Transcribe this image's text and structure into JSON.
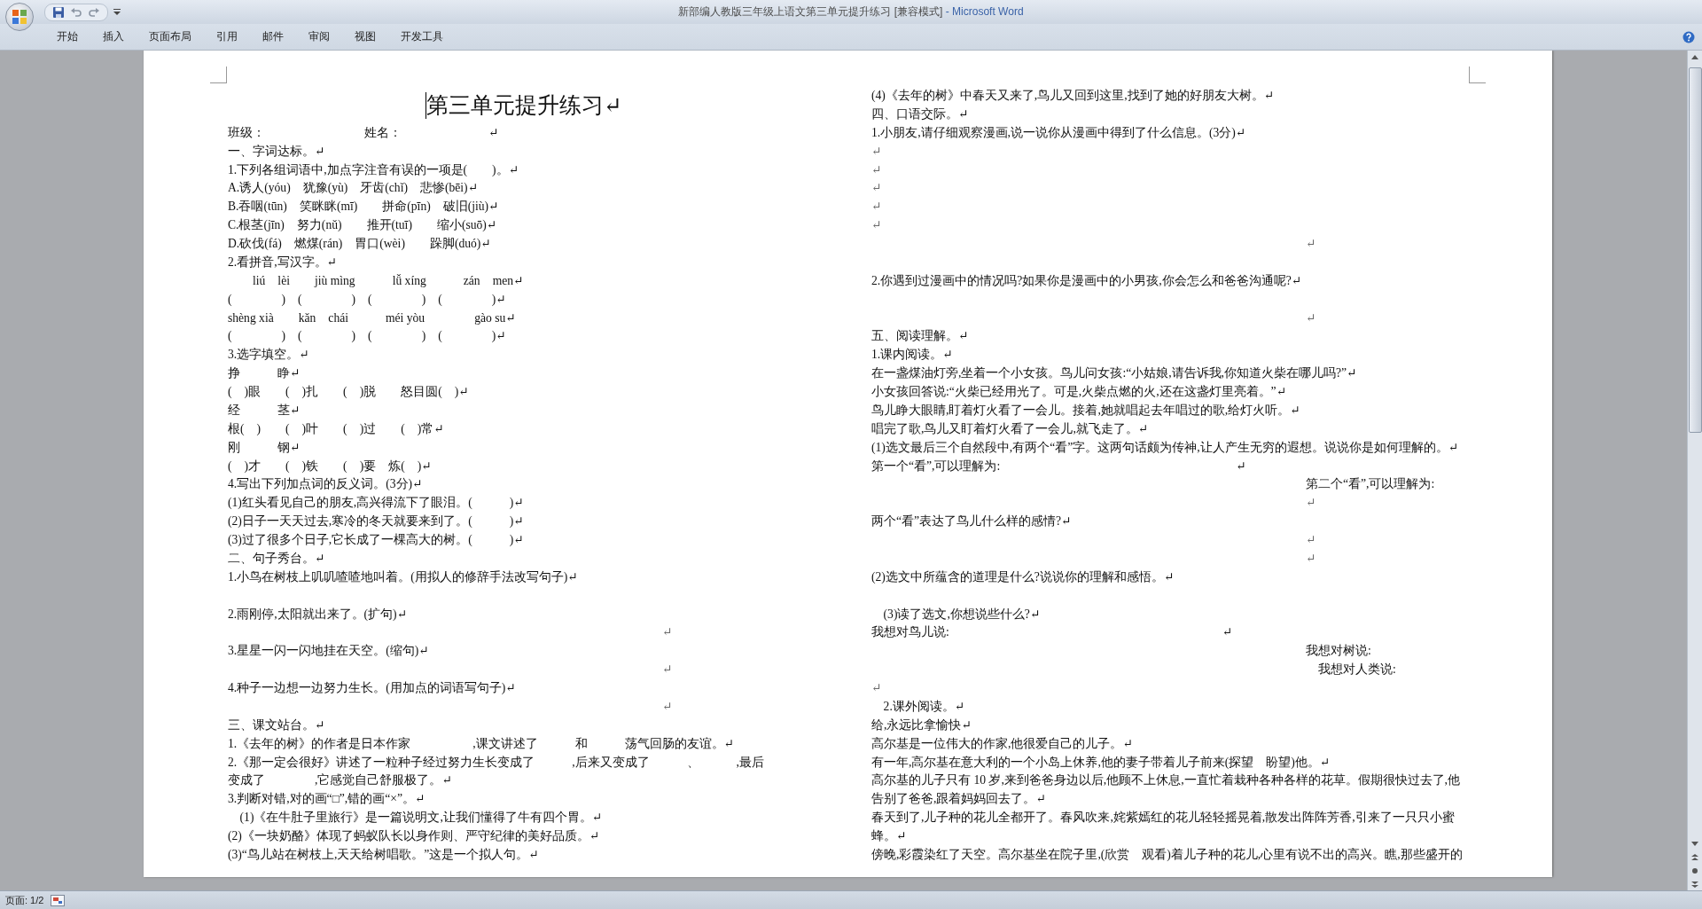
{
  "window": {
    "title": "新部编人教版三年级上语文第三单元提升练习 [兼容模式]",
    "app_name": "- Microsoft Word"
  },
  "ribbon_tabs": [
    {
      "label": "开始",
      "selected": false
    },
    {
      "label": "插入",
      "selected": false
    },
    {
      "label": "页面布局",
      "selected": false
    },
    {
      "label": "引用",
      "selected": false
    },
    {
      "label": "邮件",
      "selected": false
    },
    {
      "label": "审阅",
      "selected": false
    },
    {
      "label": "视图",
      "selected": false
    },
    {
      "label": "开发工具",
      "selected": false
    }
  ],
  "document": {
    "title": "第三单元提升练习↵",
    "left_column": [
      {
        "kind": "text",
        "text": "班级：　　　　　　　　姓名：　　　　　　　↵"
      },
      {
        "kind": "text",
        "text": "一、字词达标。↵"
      },
      {
        "kind": "text",
        "text": "1.下列各组词语中,加点字注音有误的一项是(　　)。↵"
      },
      {
        "kind": "text",
        "text": "A.诱人(yóu)　犹豫(yù)　牙齿(chǐ)　悲惨(bēi)↵"
      },
      {
        "kind": "text",
        "text": "B.吞咽(tūn)　笑眯眯(mī)　　拼命(pīn)　破旧(jiù)↵"
      },
      {
        "kind": "text",
        "text": "C.根茎(jīn)　努力(nǔ)　　推开(tuī)　　缩小(suō)↵"
      },
      {
        "kind": "text",
        "text": "D.砍伐(fá)　燃煤(rán)　胃口(wèi)　　跺脚(duó)↵"
      },
      {
        "kind": "text",
        "text": "2.看拼音,写汉字。↵"
      },
      {
        "kind": "text",
        "text": "　　liú　lèi　　jiù mìng　　　lǚ xíng　　　zán　men↵"
      },
      {
        "kind": "text",
        "text": "(　　　　)　(　　　　)　(　　　　)　(　　　　)↵"
      },
      {
        "kind": "text",
        "text": "shèng xià　　kǎn　chái　　　méi yòu　　　　gào su↵"
      },
      {
        "kind": "text",
        "text": "(　　　　)　(　　　　)　(　　　　)　(　　　　)↵"
      },
      {
        "kind": "text",
        "text": "3.选字填空。↵"
      },
      {
        "kind": "text",
        "text": "挣　　　睁↵"
      },
      {
        "kind": "text",
        "text": "(　)眼　　(　)扎　　(　)脱　　怒目圆(　)↵"
      },
      {
        "kind": "text",
        "text": "经　　　茎↵"
      },
      {
        "kind": "text",
        "text": "根(　)　　(　)叶　　(　)过　　(　)常↵"
      },
      {
        "kind": "text",
        "text": "刚　　　钢↵"
      },
      {
        "kind": "text",
        "text": "(　)才　　(　)铁　　(　)要　炼(　)↵"
      },
      {
        "kind": "text",
        "text": "4.写出下列加点词的反义词。(3分)↵"
      },
      {
        "kind": "text",
        "text": "(1)红头看见自己的朋友,高兴得流下了眼泪。(　　　)↵"
      },
      {
        "kind": "text",
        "text": "(2)日子一天天过去,寒冷的冬天就要来到了。(　　　)↵"
      },
      {
        "kind": "text",
        "text": "(3)过了很多个日子,它长成了一棵高大的树。(　　　)↵"
      },
      {
        "kind": "text",
        "text": "二、句子秀台。↵"
      },
      {
        "kind": "text",
        "text": "1.小鸟在树枝上叽叽喳喳地叫着。(用拟人的修辞手法改写句子)↵"
      },
      {
        "kind": "text",
        "text": "2.雨刚停,太阳就出来了。(扩句)↵",
        "gap": true
      },
      {
        "kind": "mark",
        "text": "　　　　　　　　　　　　　　　　　　　　　　　　　　　　　　　　　　　↵"
      },
      {
        "kind": "text",
        "text": "3.星星一闪一闪地挂在天空。(缩句)↵"
      },
      {
        "kind": "mark",
        "text": "　　　　　　　　　　　　　　　　　　　　　　　　　　　　　　　　　　　↵"
      },
      {
        "kind": "text",
        "text": "4.种子一边想一边努力生长。(用加点的词语写句子)↵"
      },
      {
        "kind": "mark",
        "text": "　　　　　　　　　　　　　　　　　　　　　　　　　　　　　　　　　　　↵"
      },
      {
        "kind": "text",
        "text": "三、课文站台。↵"
      },
      {
        "kind": "text",
        "text": "1.《去年的树》的作者是日本作家　　　　　,课文讲述了　　　和　　　荡气回肠的友谊。↵"
      },
      {
        "kind": "text",
        "text": "2.《那一定会很好》讲述了一粒种子经过努力生长变成了　　　,后来又变成了　　　、　　　,最后"
      },
      {
        "kind": "text",
        "text": "变成了　　　　,它感觉自己舒服极了。↵"
      },
      {
        "kind": "text",
        "text": "3.判断对错,对的画“□”,错的画“×”。↵"
      },
      {
        "kind": "text",
        "text": "(1)《在牛肚子里旅行》是一篇说明文,让我们懂得了牛有四个胃。↵",
        "indent": true
      },
      {
        "kind": "text",
        "text": "(2)《一块奶酪》体现了蚂蚁队长以身作则、严守纪律的美好品质。↵"
      },
      {
        "kind": "text",
        "text": "(3)“鸟儿站在树枝上,天天给树唱歌。”这是一个拟人句。↵"
      }
    ],
    "right_column": [
      {
        "kind": "text",
        "text": "(4)《去年的树》中春天又来了,鸟儿又回到这里,找到了她的好朋友大树。↵"
      },
      {
        "kind": "text",
        "text": "四、口语交际。↵"
      },
      {
        "kind": "text",
        "text": "1.小朋友,请仔细观察漫画,说一说你从漫画中得到了什么信息。(3分)↵"
      },
      {
        "kind": "mark",
        "text": "↵"
      },
      {
        "kind": "mark",
        "text": "↵"
      },
      {
        "kind": "mark",
        "text": "↵"
      },
      {
        "kind": "mark",
        "text": "↵"
      },
      {
        "kind": "mark",
        "text": "↵"
      },
      {
        "kind": "mark",
        "text": "　　　　　　　　　　　　　　　　　　　　　　　　　　　　　　　　　　　↵"
      },
      {
        "kind": "text",
        "text": "2.你遇到过漫画中的情况吗?如果你是漫画中的小男孩,你会怎么和爸爸沟通呢?↵",
        "gap": true
      },
      {
        "kind": "mark",
        "text": "　　　　　　　　　　　　　　　　　　　　　　　　　　　　　　　　　　　↵",
        "gap": true
      },
      {
        "kind": "text",
        "text": "五、阅读理解。↵"
      },
      {
        "kind": "text",
        "text": "1.课内阅读。↵"
      },
      {
        "kind": "text",
        "text": "在一盏煤油灯旁,坐着一个小女孩。鸟儿问女孩:“小姑娘,请告诉我,你知道火柴在哪儿吗?”↵"
      },
      {
        "kind": "text",
        "text": "小女孩回答说:“火柴已经用光了。可是,火柴点燃的火,还在这盏灯里亮着。”↵"
      },
      {
        "kind": "text",
        "text": "鸟儿睁大眼睛,盯着灯火看了一会儿。接着,她就唱起去年唱过的歌,给灯火听。↵"
      },
      {
        "kind": "text",
        "text": "唱完了歌,鸟儿又盯着灯火看了一会儿,就飞走了。↵"
      },
      {
        "kind": "text",
        "text": "(1)选文最后三个自然段中,有两个“看”字。这两句话颇为传神,让人产生无穷的遐想。说说你是如何理解的。↵"
      },
      {
        "kind": "text",
        "text": "第一个“看”,可以理解为:　　　　　　　　　　　　　　　　　　　↵"
      },
      {
        "kind": "text",
        "text": "　　　　　　　　　　　　　　　　　　　　　　　　　　　　　　　　　　　第二个“看”,可以理解为:"
      },
      {
        "kind": "mark",
        "text": "　　　　　　　　　　　　　　　　　　　　　　　　　　　　　　　　　　　↵"
      },
      {
        "kind": "text",
        "text": "两个“看”表达了鸟儿什么样的感情?↵"
      },
      {
        "kind": "mark",
        "text": "　　　　　　　　　　　　　　　　　　　　　　　　　　　　　　　　　　　↵"
      },
      {
        "kind": "mark",
        "text": "　　　　　　　　　　　　　　　　　　　　　　　　　　　　　　　　　　　↵"
      },
      {
        "kind": "text",
        "text": "(2)选文中所蕴含的道理是什么?说说你的理解和感悟。↵"
      },
      {
        "kind": "text",
        "text": "(3)读了选文,你想说些什么?↵",
        "gap": true,
        "indent": true
      },
      {
        "kind": "text",
        "text": "我想对鸟儿说:　　　　　　　　　　　　　　　　　　　　　　↵"
      },
      {
        "kind": "text",
        "text": "　　　　　　　　　　　　　　　　　　　　　　　　　　　　　　　　　　　我想对树说:"
      },
      {
        "kind": "text",
        "text": "　　　　　　　　　　　　　　　　　　　　　　　　　　　　　　　　　　　　我想对人类说:"
      },
      {
        "kind": "mark",
        "text": "↵"
      },
      {
        "kind": "text",
        "text": "2.课外阅读。↵",
        "indent": true
      },
      {
        "kind": "text",
        "text": "给,永远比拿愉快↵"
      },
      {
        "kind": "text",
        "text": "高尔基是一位伟大的作家,他很爱自己的儿子。↵"
      },
      {
        "kind": "text",
        "text": "有一年,高尔基在意大利的一个小岛上休养,他的妻子带着儿子前来(探望　盼望)他。↵"
      },
      {
        "kind": "text",
        "text": "高尔基的儿子只有 10 岁,来到爸爸身边以后,他顾不上休息,一直忙着栽种各种各样的花草。假期很快过去了,他"
      },
      {
        "kind": "text",
        "text": "告别了爸爸,跟着妈妈回去了。↵"
      },
      {
        "kind": "text",
        "text": "春天到了,儿子种的花儿全都开了。春风吹来,姹紫嫣红的花儿轻轻摇晃着,散发出阵阵芳香,引来了一只只小蜜"
      },
      {
        "kind": "text",
        "text": "蜂。↵"
      },
      {
        "kind": "text",
        "text": "傍晚,彩霞染红了天空。高尔基坐在院子里,(欣赏　观看)着儿子种的花儿,心里有说不出的高兴。瞧,那些盛开的"
      }
    ]
  },
  "status_bar": {
    "page": "页面: 1/2"
  }
}
